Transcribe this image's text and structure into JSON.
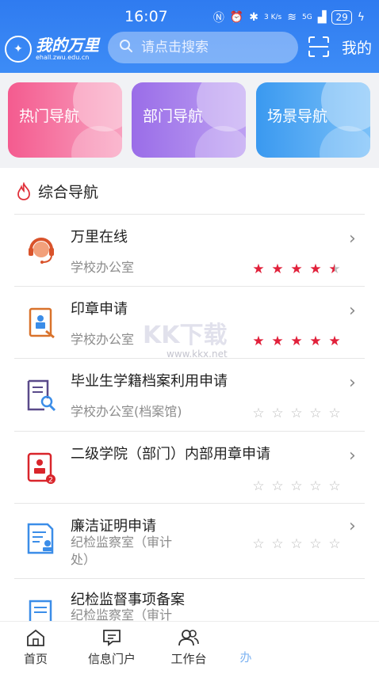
{
  "status": {
    "time": "16:07",
    "network": "5G",
    "speed": "3 K/s",
    "battery": "29"
  },
  "header": {
    "logo_name": "我的万里",
    "logo_domain": "ehall.zwu.edu.cn",
    "search_placeholder": "请点击搜索",
    "mine_label": "我的"
  },
  "nav_cards": [
    {
      "label": "热门导航"
    },
    {
      "label": "部门导航"
    },
    {
      "label": "场景导航"
    }
  ],
  "section_title": "综合导航",
  "items": [
    {
      "title": "万里在线",
      "dept": "学校办公室",
      "rating": 4.5
    },
    {
      "title": "印章申请",
      "dept": "学校办公室",
      "rating": 5
    },
    {
      "title": "毕业生学籍档案利用申请",
      "dept": "学校办公室(档案馆)",
      "rating": 0
    },
    {
      "title": "二级学院（部门）内部用章申请",
      "dept": "",
      "rating": 0
    },
    {
      "title": "廉洁证明申请",
      "dept_line1": "纪检监察室（审计",
      "dept_line2": "处）",
      "rating": 0
    },
    {
      "title": "纪检监督事项备案",
      "dept_line1": "纪检监察室（审计",
      "rating": null
    }
  ],
  "tabs": [
    {
      "label": "首页",
      "icon": "home-icon"
    },
    {
      "label": "信息门户",
      "icon": "message-icon"
    },
    {
      "label": "工作台",
      "icon": "users-icon"
    },
    {
      "label": "办",
      "icon": "partial-tab"
    }
  ],
  "watermark": {
    "big": "KK下载",
    "small": "www.kkx.net"
  },
  "colors": {
    "header_blue": "#3a86f3",
    "star_red": "#e1203a",
    "hot_pink": "#f45b8f",
    "dept_purple": "#9a6de8",
    "scene_blue": "#3a99f0"
  }
}
